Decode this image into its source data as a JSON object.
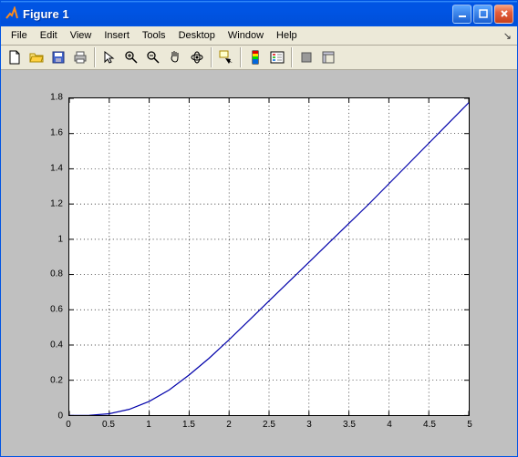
{
  "window": {
    "title": "Figure 1",
    "buttons": {
      "min": "_",
      "max": "□",
      "close": "×"
    }
  },
  "menubar": {
    "items": [
      "File",
      "Edit",
      "View",
      "Insert",
      "Tools",
      "Desktop",
      "Window",
      "Help"
    ]
  },
  "toolbar": {
    "icons": [
      "new-file-icon",
      "open-file-icon",
      "save-icon",
      "print-icon",
      "|",
      "pointer-icon",
      "zoom-in-icon",
      "zoom-out-icon",
      "pan-icon",
      "rotate3d-icon",
      "|",
      "data-cursor-icon",
      "|",
      "colorbar-icon",
      "legend-icon",
      "|",
      "hide-plot-tools-icon",
      "show-plot-tools-icon"
    ]
  },
  "chart_data": {
    "type": "line",
    "x": [
      0,
      0.25,
      0.5,
      0.75,
      1.0,
      1.25,
      1.5,
      1.75,
      2.0,
      2.25,
      2.5,
      2.75,
      3.0,
      3.25,
      3.5,
      3.75,
      4.0,
      4.25,
      4.5,
      4.75,
      5.0
    ],
    "y": [
      0.0,
      0.001,
      0.01,
      0.035,
      0.08,
      0.145,
      0.23,
      0.325,
      0.43,
      0.54,
      0.65,
      0.76,
      0.87,
      0.98,
      1.09,
      1.2,
      1.315,
      1.43,
      1.545,
      1.66,
      1.775
    ],
    "xlim": [
      0,
      5
    ],
    "ylim": [
      0,
      1.8
    ],
    "xticks": [
      0,
      0.5,
      1,
      1.5,
      2,
      2.5,
      3,
      3.5,
      4,
      4.5,
      5
    ],
    "yticks": [
      0,
      0.2,
      0.4,
      0.6,
      0.8,
      1,
      1.2,
      1.4,
      1.6,
      1.8
    ],
    "grid": true,
    "line_color": "#0000aa"
  }
}
